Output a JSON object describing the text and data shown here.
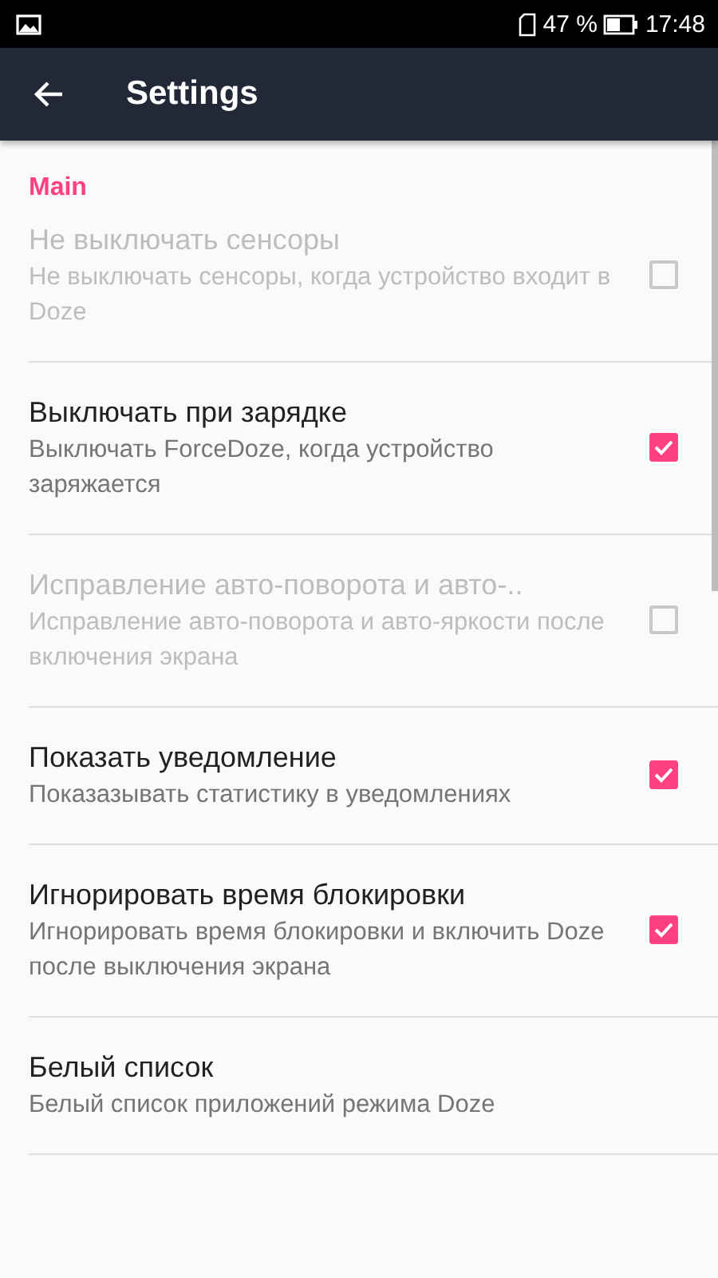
{
  "status_bar": {
    "battery_percent": "47 %",
    "time": "17:48"
  },
  "app_bar": {
    "title": "Settings"
  },
  "section": {
    "title": "Main"
  },
  "items": [
    {
      "kind": "checkbox",
      "title": "Не выключать сенсоры",
      "summary": "Не выключать сенсоры, когда устройство входит в Doze",
      "disabled": true,
      "checked": false
    },
    {
      "kind": "checkbox",
      "title": "Выключать при зарядке",
      "summary": "Выключать ForceDoze, когда устройство заряжается",
      "disabled": false,
      "checked": true
    },
    {
      "kind": "checkbox",
      "title": "Исправление авто-поворота и авто-..",
      "summary": "Исправление авто-поворота и авто-яркости после включения экрана",
      "disabled": true,
      "checked": false
    },
    {
      "kind": "checkbox",
      "title": "Показать уведомление",
      "summary": "Показазывать статистику в уведомлениях",
      "disabled": false,
      "checked": true
    },
    {
      "kind": "checkbox",
      "title": "Игнорировать время блокировки",
      "summary": "Игнорировать время блокировки и включить Doze после выключения экрана",
      "disabled": false,
      "checked": true
    },
    {
      "kind": "plain",
      "title": "Белый список",
      "summary": "Белый список приложений режима Doze",
      "disabled": false
    }
  ]
}
